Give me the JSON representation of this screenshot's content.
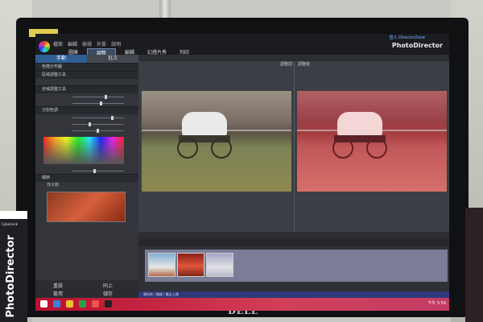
{
  "photo_label": "",
  "sticker": {
    "text": "CyberLink"
  },
  "monitor": {
    "brand": "DELL"
  },
  "app": {
    "name": "PhotoDirector",
    "user_link": "登入 DirectorZone",
    "menus": [
      "檔案",
      "編輯",
      "檢視",
      "外掛",
      "說明"
    ],
    "modes": [
      "圖庫",
      "調整",
      "編輯",
      "幻燈片秀",
      "列印"
    ],
    "active_mode": "調整"
  },
  "sidebar": {
    "tabs": [
      "手動",
      "批次"
    ],
    "sections": [
      "色階分布圖",
      "區域調整工具",
      "全域調整工具",
      "分割色調",
      "細節"
    ],
    "detail_label": "放大鏡",
    "footer": [
      "重設",
      "同上",
      "套用",
      "儲存"
    ]
  },
  "viewer": {
    "before_label": "調整前",
    "after_label": "調整後"
  },
  "filmstrip": {
    "status": "資料夾 / 開啟 / 最近上傳"
  },
  "taskbar": {
    "time": "下午 3:59"
  },
  "colors": {
    "accent": "#2f5e93",
    "taskbar": "#c8283f"
  }
}
